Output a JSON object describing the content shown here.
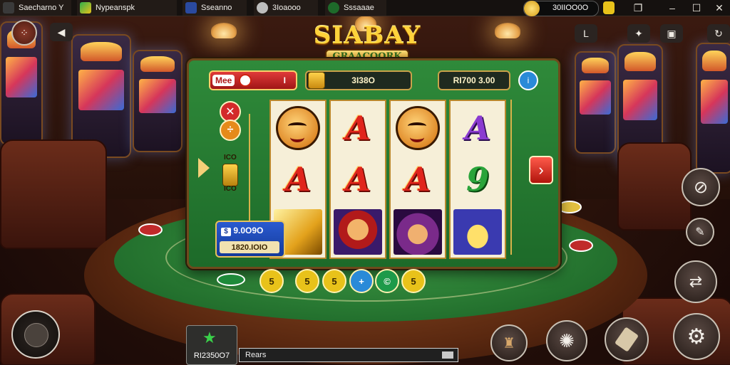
{
  "topbar": {
    "tabs": [
      {
        "label": "Saecharno Y",
        "icon": "app-logo-icon"
      },
      {
        "label": "Nypeanspk",
        "icon": "store-icon"
      },
      {
        "label": "Sseanno",
        "icon": "slot-app-icon"
      },
      {
        "label": "3Ioaooo",
        "icon": "clock-icon"
      },
      {
        "label": "Sssaaae",
        "icon": "game-app-icon"
      }
    ],
    "balance": "30IIOO0O",
    "controls": [
      "minimize",
      "maximize",
      "close"
    ]
  },
  "game": {
    "title_line1": "SIABAY",
    "title_line2": "GRAACOORK",
    "mode_label": "Mee",
    "mode_value": "I",
    "coins": "3I38O",
    "bet": "RI700 3.00",
    "info_glyph": "i",
    "side_text_top": "ICO",
    "side_text_bottom": "ICO",
    "win_amount": "9.0O9O",
    "win_sub": "1820.IOIO",
    "reel_glyphs": {
      "r2c2": "A",
      "r2c3": "A",
      "r2c4": "A",
      "r1c2": "A",
      "r1c4": "A",
      "r2c5": "9"
    }
  },
  "chips": [
    {
      "label": "5",
      "color": "#e8c21a"
    },
    {
      "label": "5",
      "color": "#e8c21a"
    },
    {
      "label": "5",
      "color": "#e8c21a"
    },
    {
      "label": "+",
      "color": "#2a8ad8"
    },
    {
      "label": "©",
      "color": "#1e9a4a"
    },
    {
      "label": "5",
      "color": "#e8c21a"
    }
  ],
  "bottom": {
    "card_value": "RI2350O7",
    "message_placeholder": "Rears"
  }
}
